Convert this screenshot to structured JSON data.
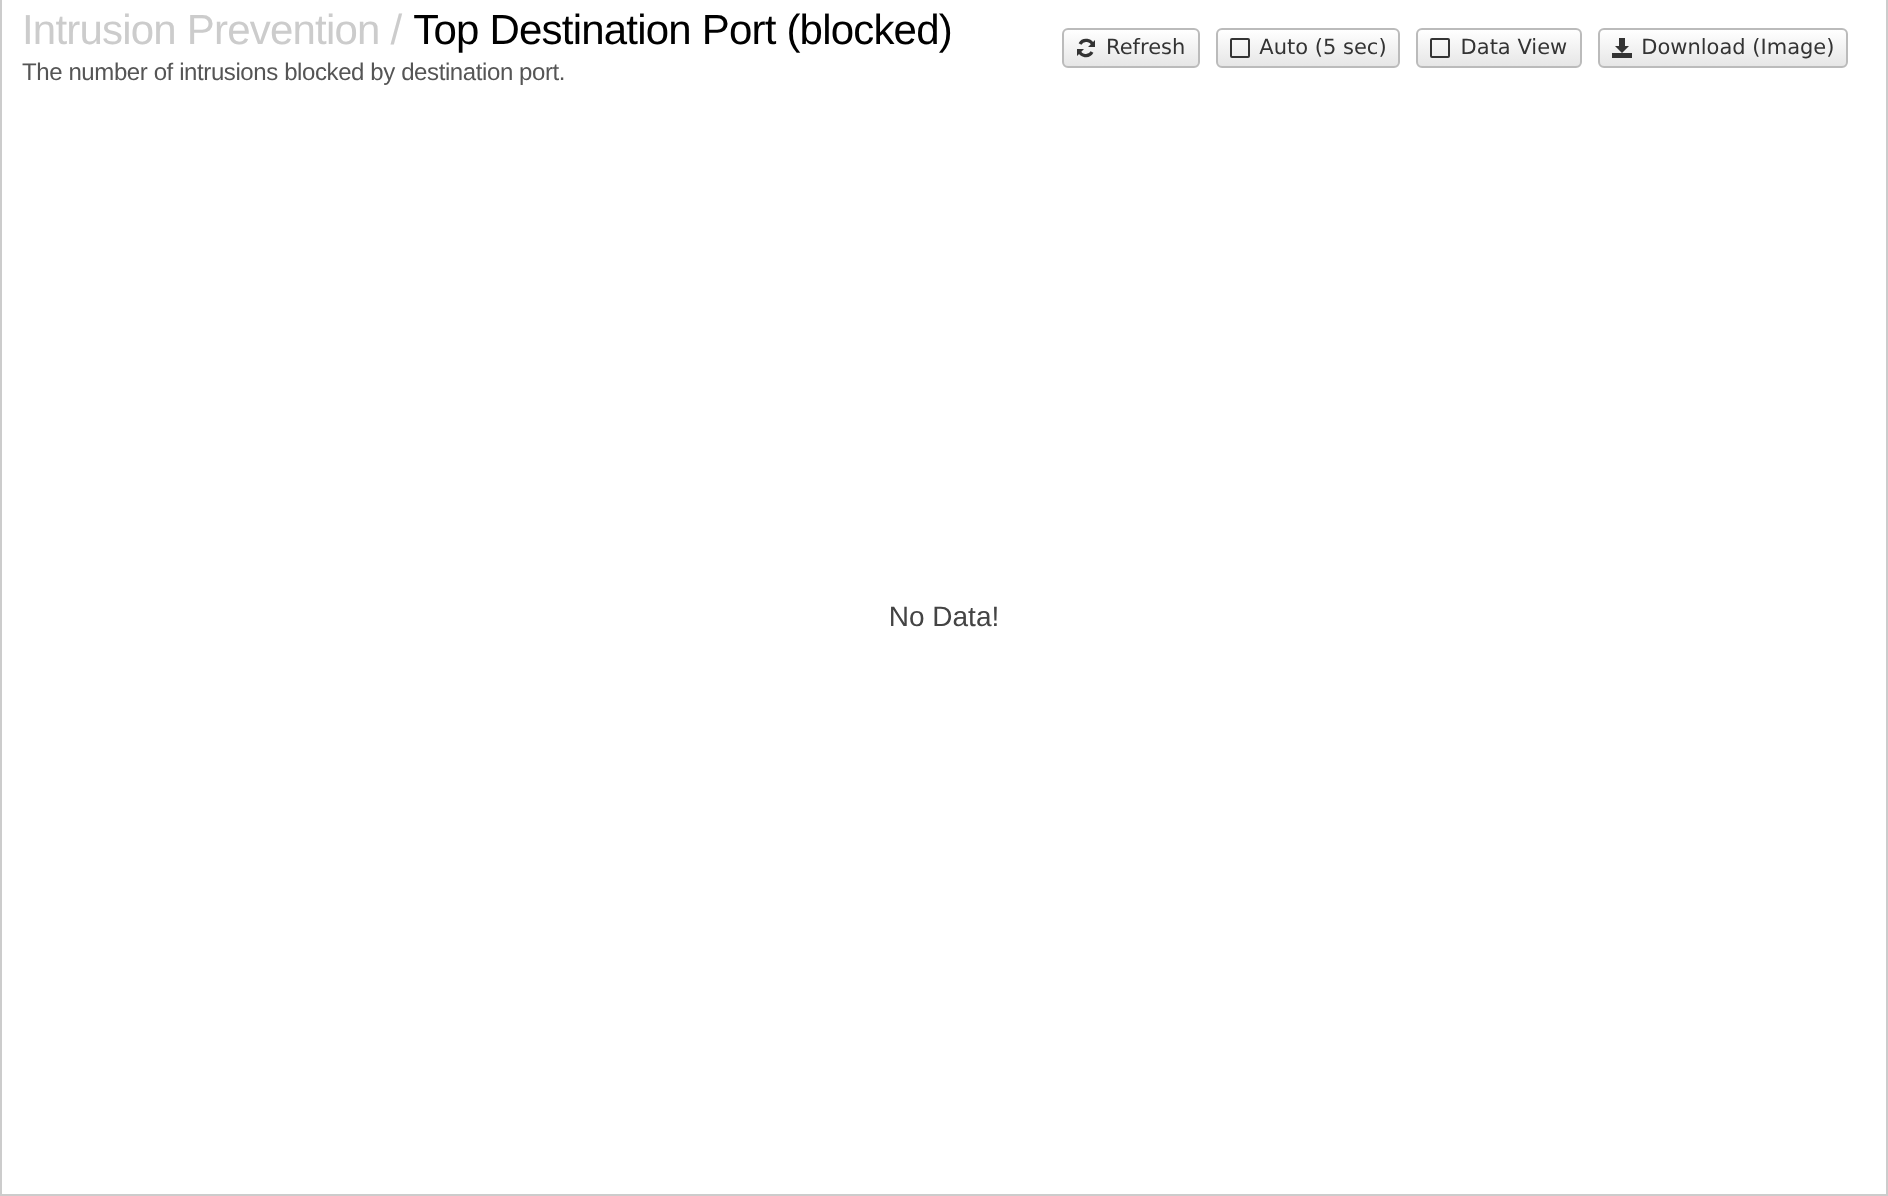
{
  "header": {
    "breadcrumb": "Intrusion Prevention /",
    "title": "Top Destination Port (blocked)",
    "description": "The number of intrusions blocked by destination port."
  },
  "toolbar": [
    {
      "kind": "refresh",
      "label": "Refresh"
    },
    {
      "kind": "toggle",
      "label": "Auto (5 sec)",
      "checked": false
    },
    {
      "kind": "toggle",
      "label": "Data View",
      "checked": false
    },
    {
      "kind": "download",
      "label": "Download (Image)"
    }
  ],
  "chart": {
    "message": "No Data!"
  }
}
